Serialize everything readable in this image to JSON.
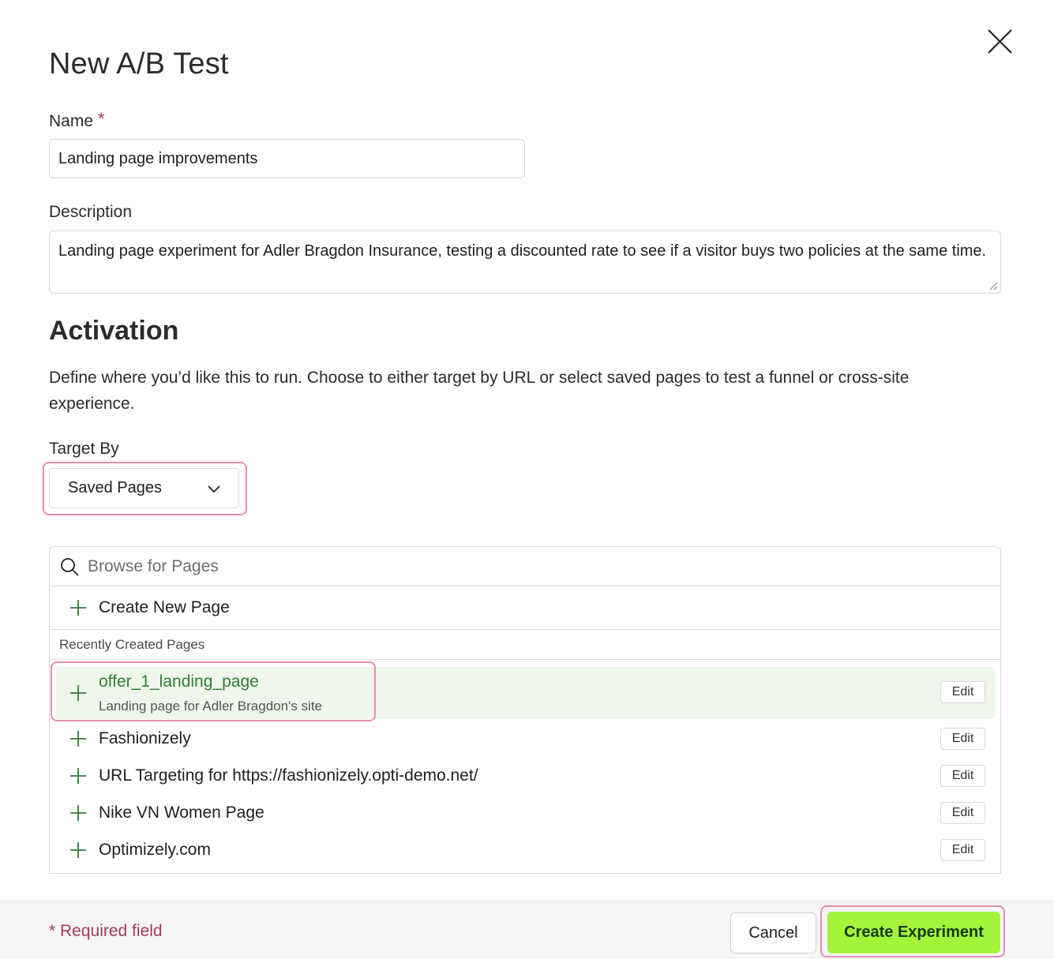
{
  "dialog": {
    "title": "New A/B Test"
  },
  "form": {
    "name_label": "Name",
    "required_star": "*",
    "name_value": "Landing page improvements",
    "description_label": "Description",
    "description_value": "Landing page experiment for Adler Bragdon Insurance, testing a discounted rate to see if a visitor buys two policies at the same time."
  },
  "activation": {
    "title": "Activation",
    "help_text": "Define where you’d like this to run. Choose to either target by URL or select saved pages to test a funnel or cross-site experience.",
    "target_by_label": "Target By",
    "target_by_value": "Saved Pages"
  },
  "pages": {
    "search_placeholder": "Browse for Pages",
    "create_label": "Create New Page",
    "recent_header": "Recently Created Pages",
    "edit_label": "Edit",
    "items": [
      {
        "name": "offer_1_landing_page",
        "description": "Landing page for Adler Bragdon's site"
      },
      {
        "name": "Fashionizely"
      },
      {
        "name": "URL Targeting for https://fashionizely.opti-demo.net/"
      },
      {
        "name": "Nike VN Women Page"
      },
      {
        "name": "Optimizely.com"
      }
    ]
  },
  "footer": {
    "required_note": "* Required field",
    "cancel_label": "Cancel",
    "create_label": "Create Experiment"
  },
  "colors": {
    "accent_green_button": "#a6f33c",
    "highlight_pink": "#e58db4",
    "required_red": "#a23a5f",
    "selected_row_bg": "#eef7ea",
    "plus_green": "#2e7d32"
  }
}
